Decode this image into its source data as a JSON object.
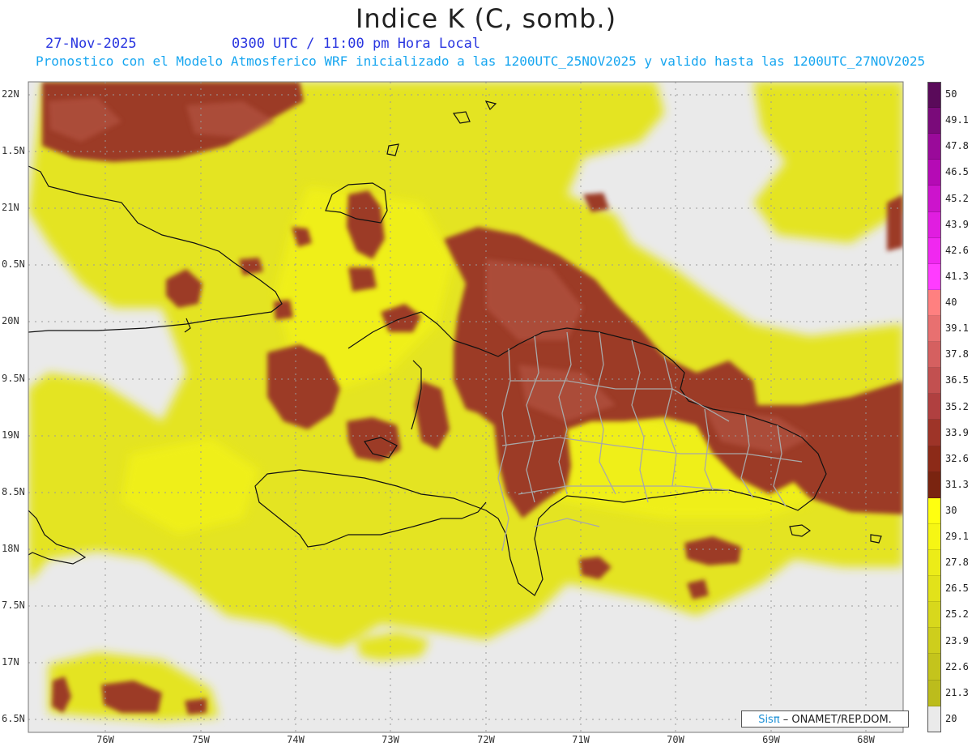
{
  "header": {
    "title": "Indice K (C, somb.)",
    "date": "27-Nov-2025",
    "time": "0300 UTC / 11:00 pm Hora Local",
    "subtitle": "Pronostico con el Modelo Atmosferico WRF inicializado a las 1200UTC_25NOV2025 y valido hasta las  1200UTC_27NOV2025"
  },
  "axes": {
    "lat_labels": [
      "22N",
      "1.5N",
      "21N",
      "0.5N",
      "20N",
      "9.5N",
      "19N",
      "8.5N",
      "18N",
      "7.5N",
      "17N",
      "6.5N"
    ],
    "lon_labels": [
      "76W",
      "75W",
      "74W",
      "73W",
      "72W",
      "71W",
      "70W",
      "69W",
      "68W"
    ]
  },
  "colorbar": {
    "labels": [
      "50",
      "49.1",
      "47.8",
      "46.5",
      "45.2",
      "43.9",
      "42.6",
      "41.3",
      "40",
      "39.1",
      "37.8",
      "36.5",
      "35.2",
      "33.9",
      "32.6",
      "31.3",
      "30",
      "29.1",
      "27.8",
      "26.5",
      "25.2",
      "23.9",
      "22.6",
      "21.3",
      "20"
    ],
    "colors": [
      "#5a0a5a",
      "#7a0a7a",
      "#9a0a9a",
      "#b50ab5",
      "#cc14cc",
      "#e01ee0",
      "#f028f0",
      "#ff3cff",
      "#ff8080",
      "#e87070",
      "#d56060",
      "#c25050",
      "#b04040",
      "#9e3428",
      "#8c2a18",
      "#7a2410",
      "#ffff10",
      "#f6f614",
      "#ecec18",
      "#e2e21a",
      "#d8d81c",
      "#cece1c",
      "#c4c41c",
      "#bcbc1c",
      "#eaeaea"
    ]
  },
  "credit": {
    "brand": "Sisπ",
    "text": " – ONAMET/REP.DOM."
  },
  "colors": {
    "background": "#eaeaea",
    "low_yellow": "#e6e622",
    "high_brown": "#9a3a28"
  }
}
